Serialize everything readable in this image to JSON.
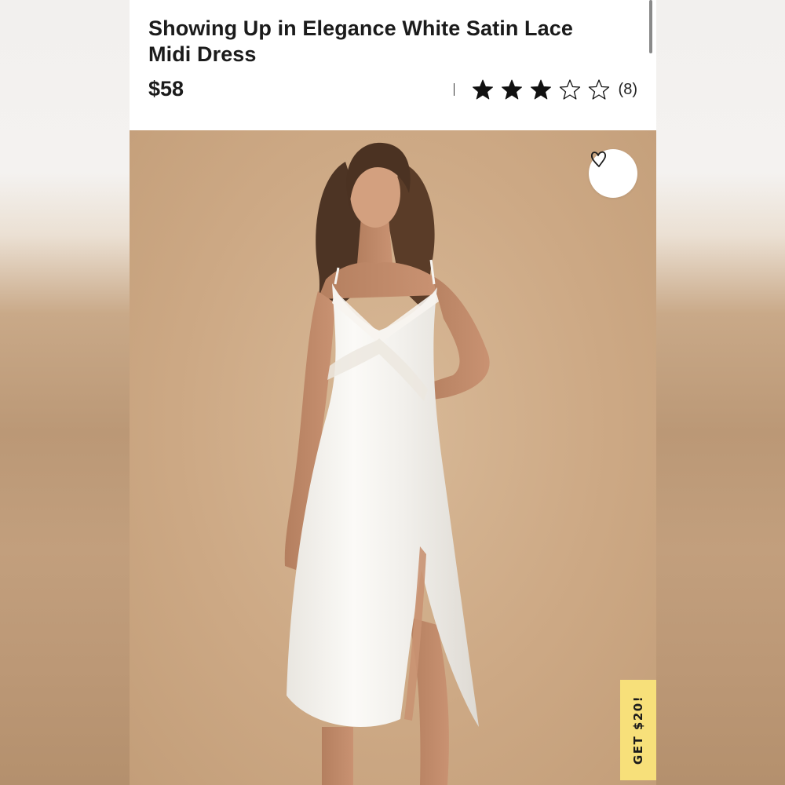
{
  "product": {
    "title": "Showing Up in Elegance White Satin Lace Midi Dress",
    "price": "$58",
    "rating": {
      "value": 3,
      "max": 5,
      "count_label": "(8)"
    }
  },
  "promo": {
    "label": "GET $20!"
  },
  "icons": {
    "favorite": "heart-outline-icon",
    "star_filled": "star-filled-icon",
    "star_empty": "star-outline-icon"
  },
  "colors": {
    "photo_background": "#cda985",
    "promo_background": "#f7e07a",
    "text": "#1b1b1b"
  }
}
